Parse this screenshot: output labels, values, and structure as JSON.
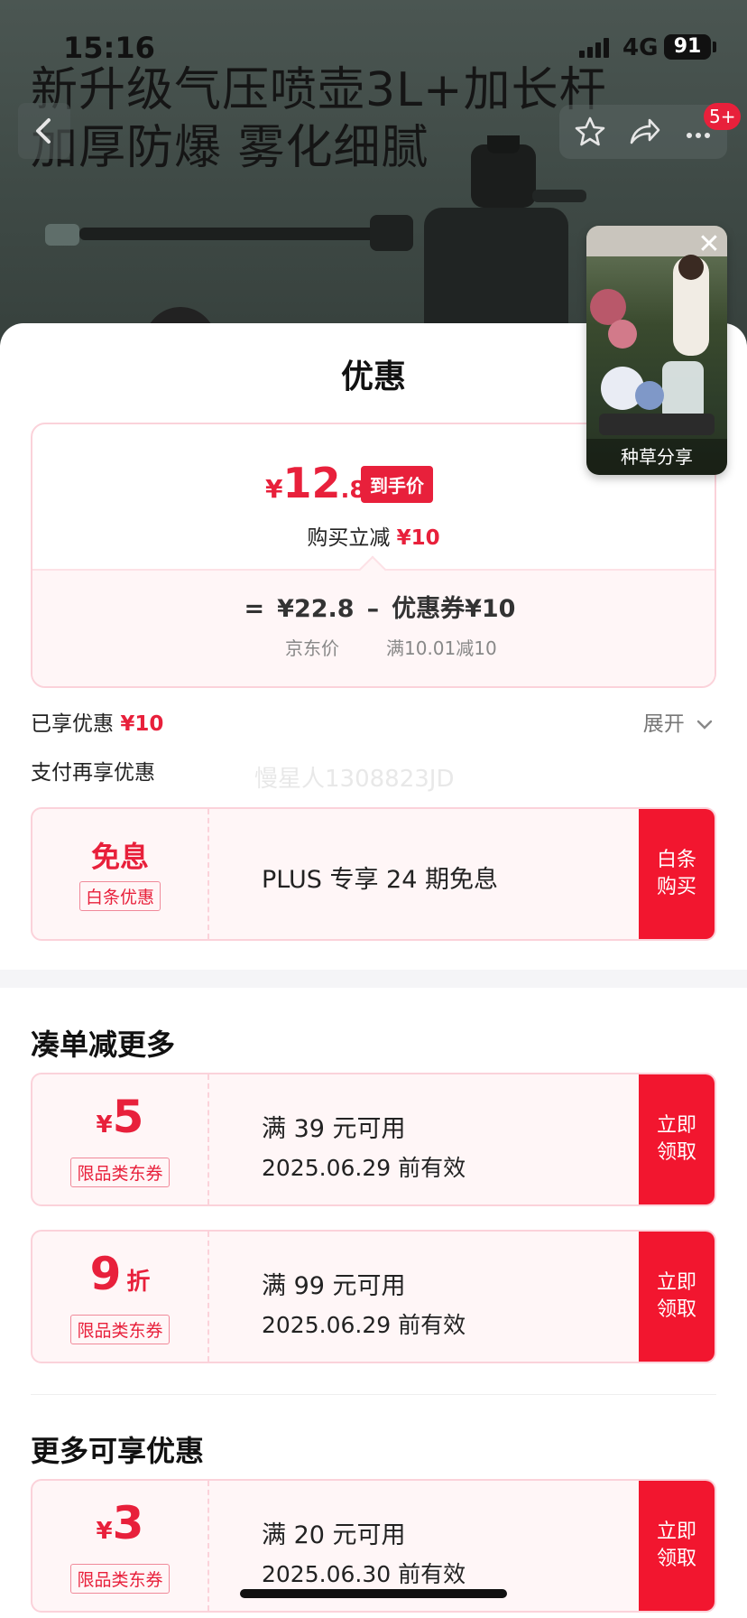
{
  "status_bar": {
    "time": "15:16",
    "network": "4G",
    "battery": "91"
  },
  "product": {
    "headline_line1": "新升级气压喷壶3L+加长杆",
    "headline_line2": "加厚防爆 雾化细腻",
    "cart_badge": "5+"
  },
  "float_video": {
    "label": "种草分享",
    "close_glyph": "✕"
  },
  "sheet": {
    "title": "优惠",
    "price": {
      "currency": "¥",
      "integer": "12",
      "decimal": ".8",
      "tag": "到手价",
      "reduce_label": "购买立减",
      "reduce_value": "¥10"
    },
    "calc": {
      "equals": "=",
      "jd_price": "¥22.8",
      "minus": "–",
      "coupon": "优惠券¥10",
      "jd_price_label": "京东价",
      "coupon_rule": "满10.01减10"
    },
    "enjoyed_label": "已享优惠",
    "enjoyed_value": "¥10",
    "expand_label": "展开",
    "pay_more_label": "支付再享优惠",
    "watermark": "慢星人1308823JD"
  },
  "baitiao": {
    "amount": "免息",
    "tag": "白条优惠",
    "text": "PLUS 专享 24 期免息",
    "button": "白条购买"
  },
  "section_more_order": {
    "title": "凑单减更多"
  },
  "coupons": [
    {
      "currency": "¥",
      "amount": "5",
      "suffix": "",
      "tag": "限品类东券",
      "line1": "满 39 元可用",
      "line2": "2025.06.29 前有效",
      "button": "立即领取"
    },
    {
      "currency": "",
      "amount": "9",
      "suffix": "折",
      "tag": "限品类东券",
      "line1": "满 99 元可用",
      "line2": "2025.06.29 前有效",
      "button": "立即领取"
    }
  ],
  "section_more": {
    "title": "更多可享优惠"
  },
  "coupons_more": [
    {
      "currency": "¥",
      "amount": "3",
      "suffix": "",
      "tag": "限品类东券",
      "line1": "满 20 元可用",
      "line2": "2025.06.30 前有效",
      "button": "立即领取"
    }
  ],
  "colors": {
    "accent": "#e8203b",
    "button": "#f2162f",
    "card_border": "#fbd2da",
    "card_bg": "#fff6f7"
  }
}
